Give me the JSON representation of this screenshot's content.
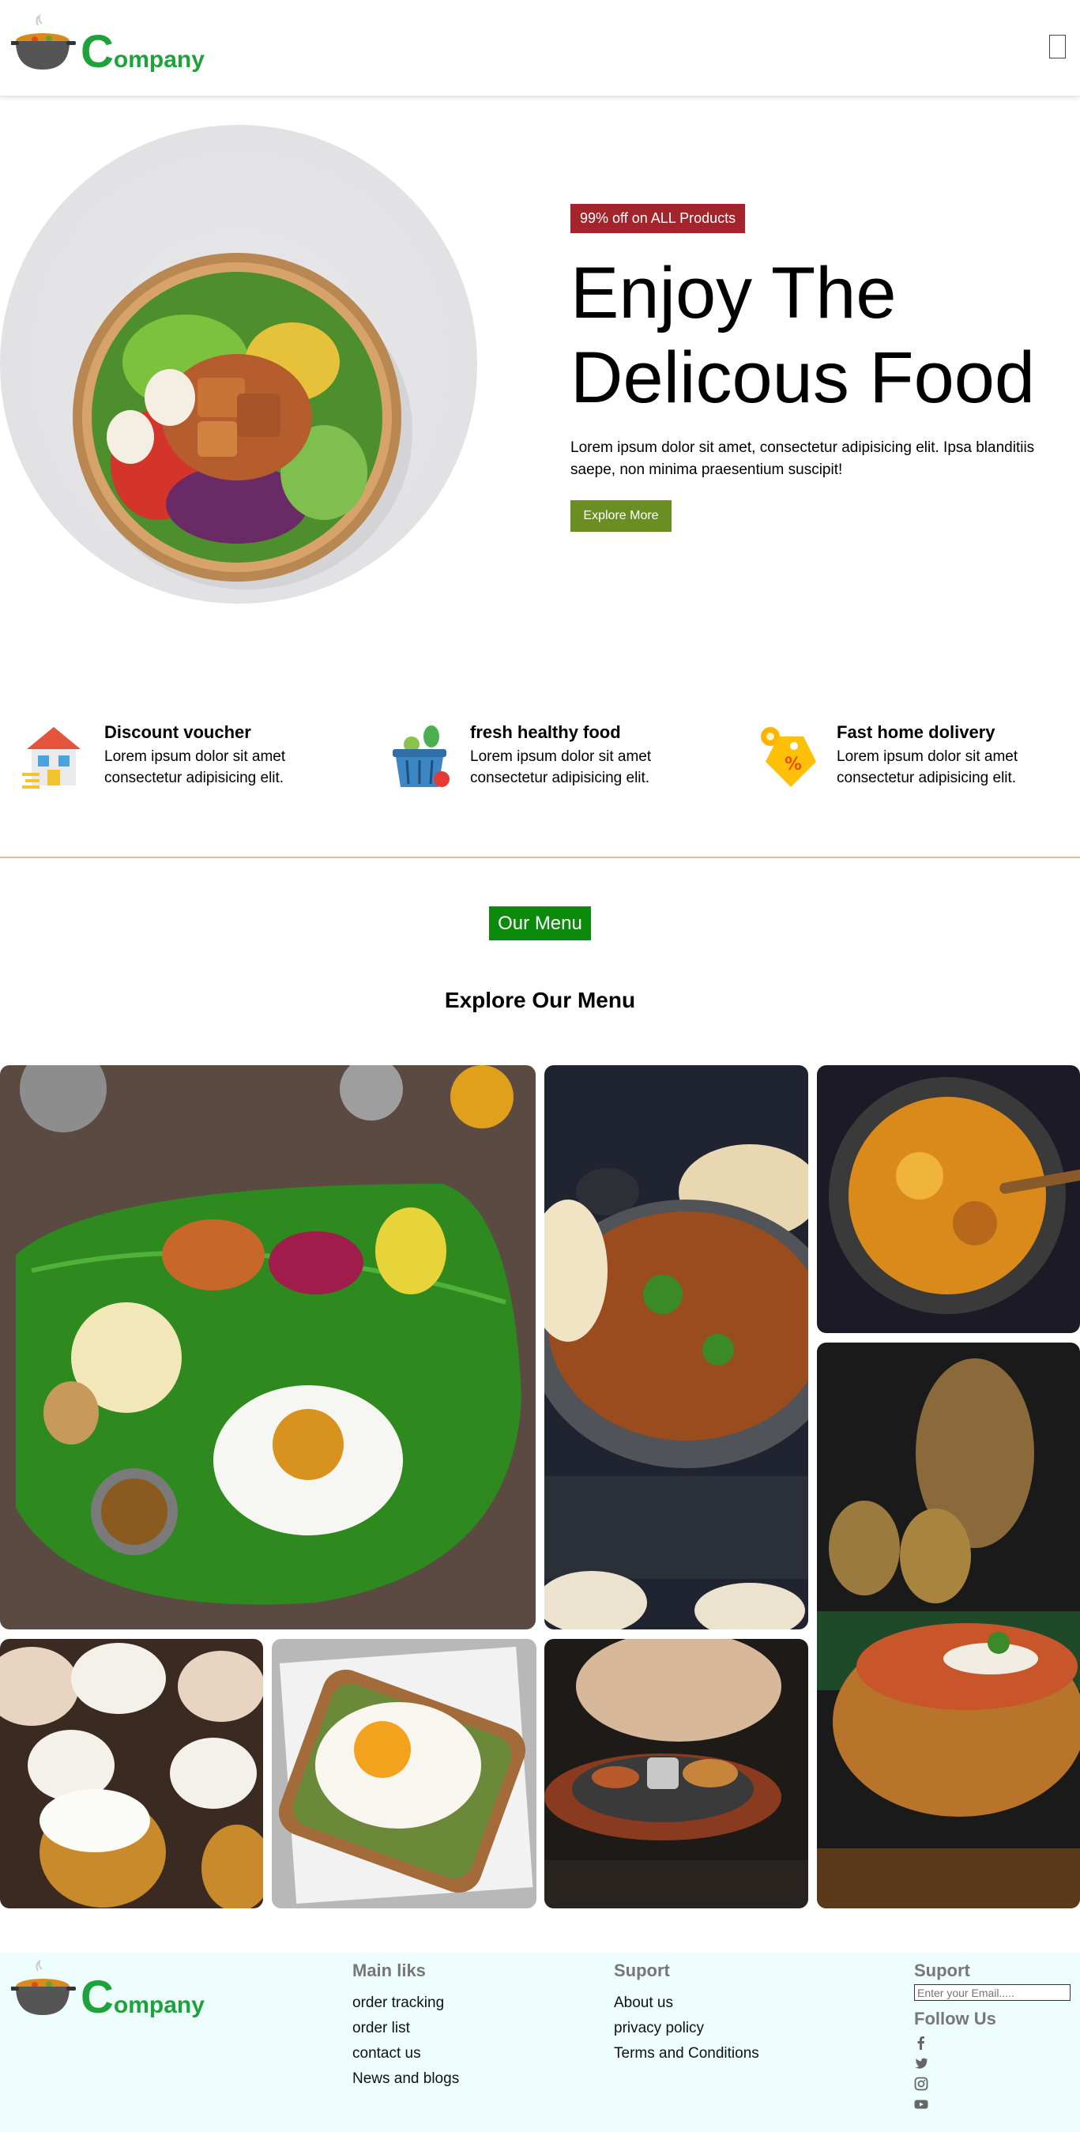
{
  "brand": {
    "logo_initial": "C",
    "logo_rest": "ompany"
  },
  "hero": {
    "badge": "99% off on ALL Products",
    "title_line1": "Enjoy The",
    "title_line2": "Delicous Food",
    "text": "Lorem ipsum dolor sit amet, consectetur adipisicing elit. Ipsa blanditiis saepe, non minima praesentium suscipit!",
    "button": "Explore More"
  },
  "features": [
    {
      "icon": "house-icon",
      "title": "Discount voucher",
      "text": "Lorem ipsum dolor sit amet consectetur adipisicing elit."
    },
    {
      "icon": "basket-icon",
      "title": "fresh healthy food",
      "text": "Lorem ipsum dolor sit amet consectetur adipisicing elit."
    },
    {
      "icon": "tag-icon",
      "title": "Fast home dolivery",
      "text": "Lorem ipsum dolor sit amet consectetur adipisicing elit."
    }
  ],
  "menu": {
    "tag": "Our Menu",
    "heading": "Explore Our Menu"
  },
  "footer": {
    "col1": {
      "title": "Main liks",
      "links": [
        "order tracking",
        "order list",
        "contact us",
        "News and blogs"
      ]
    },
    "col2": {
      "title": "Suport",
      "links": [
        "About us",
        "privacy policy",
        "Terms and Conditions"
      ]
    },
    "col3": {
      "title": "Suport",
      "email_placeholder": "Enter your Email.....",
      "follow": "Follow Us",
      "socials": [
        "facebook-icon",
        "twitter-icon",
        "instagram-icon",
        "youtube-icon"
      ]
    }
  },
  "colors": {
    "brand_green": "#1da33a",
    "badge_red": "#a3242a",
    "button_olive": "#6b8e23",
    "menu_tag_green": "#0c8a0c",
    "footer_bg": "#eefdfd",
    "divider": "#e9b794"
  }
}
